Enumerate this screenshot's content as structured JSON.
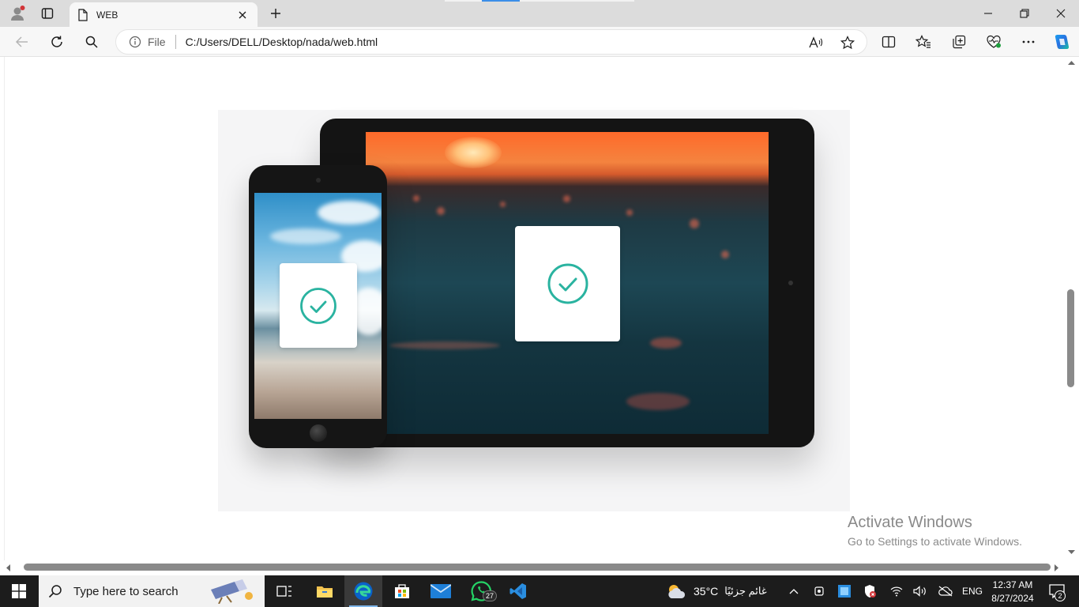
{
  "browser": {
    "tab_title": "WEB",
    "address_scheme_label": "File",
    "url": "C:/Users/DELL/Desktop/nada/web.html"
  },
  "page": {
    "hero_alt": "",
    "watermark_title": "Activate Windows",
    "watermark_subtitle": "Go to Settings to activate Windows."
  },
  "taskbar": {
    "search_placeholder": "Type here to search",
    "whatsapp_badge": "27",
    "weather_temp": "35°C",
    "weather_desc": "غائم جزئيًا",
    "language": "ENG",
    "time": "12:37 AM",
    "date": "8/27/2024",
    "notification_count": "2"
  },
  "colors": {
    "accent": "#2ab3a0",
    "edge_blue": "#0a62c9"
  }
}
